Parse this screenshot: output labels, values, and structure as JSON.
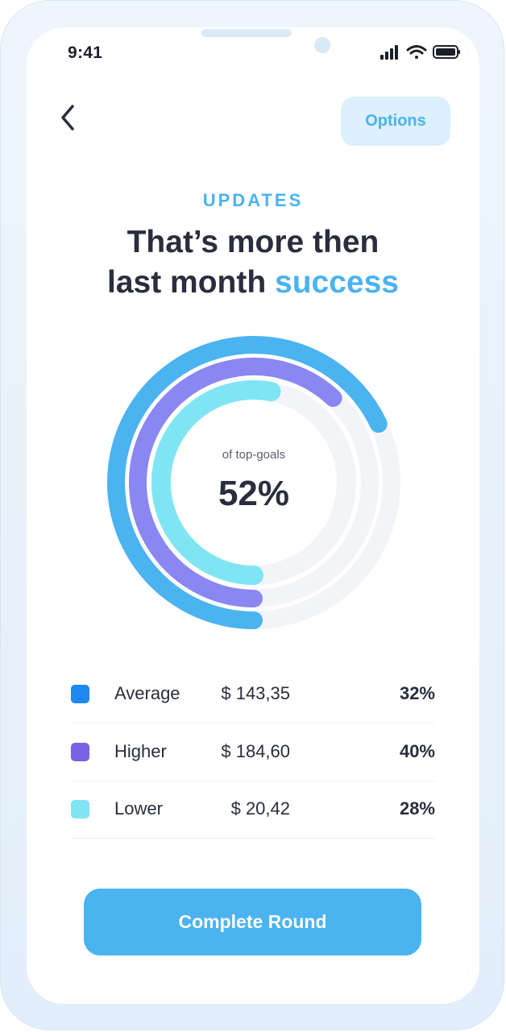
{
  "status_bar": {
    "time": "9:41",
    "icons": [
      "signal-icon",
      "wifi-icon",
      "battery-icon"
    ]
  },
  "header": {
    "back_icon": "chevron-left-icon",
    "options_label": "Options"
  },
  "hero": {
    "eyebrow": "UPDATES",
    "headline_line1": "That’s more then",
    "headline_line2_main": "last month ",
    "headline_line2_accent": "success"
  },
  "chart_data": {
    "type": "radial-bar",
    "center_label": "of top-goals",
    "center_value": "52%",
    "series": [
      {
        "name": "Average",
        "value": 32,
        "fill_fraction": 0.68,
        "color": "#4ab3f0"
      },
      {
        "name": "Higher",
        "value": 40,
        "fill_fraction": 0.62,
        "color": "#8a86f2"
      },
      {
        "name": "Lower",
        "value": 28,
        "fill_fraction": 0.53,
        "color": "#80e5f3"
      }
    ],
    "track_color": "#f2f4f8"
  },
  "legend": [
    {
      "name": "Average",
      "amount": "$ 143,35",
      "percent": "32%",
      "color": "#1e88f0"
    },
    {
      "name": "Higher",
      "amount": "$ 184,60",
      "percent": "40%",
      "color": "#7a62e4"
    },
    {
      "name": "Lower",
      "amount": "$ 20,42",
      "percent": "28%",
      "color": "#80e5f3"
    }
  ],
  "footer": {
    "cta_label": "Complete Round"
  },
  "colors": {
    "accent": "#4ab3f0",
    "text": "#2a2d3e",
    "button_bg_light": "#dcf0fd"
  }
}
